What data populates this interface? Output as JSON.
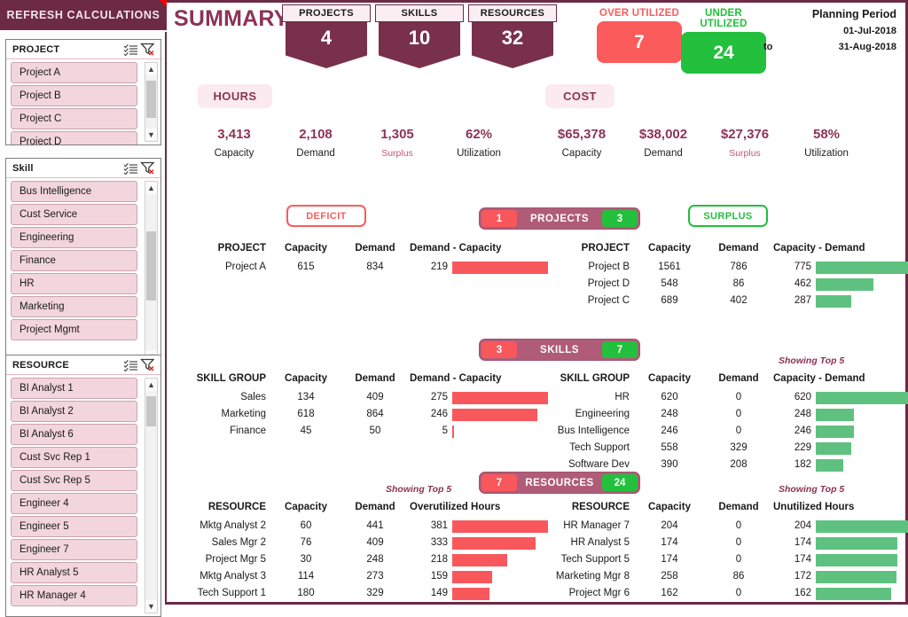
{
  "sidebar": {
    "refresh_label": "REFRESH CALCULATIONS",
    "slicers": [
      {
        "title": "PROJECT",
        "multiselect_icon": "multi-select-icon",
        "clear_icon": "clear-filter-icon",
        "items": [
          "Project A",
          "Project B",
          "Project C",
          "Project D"
        ]
      },
      {
        "title": "Skill",
        "multiselect_icon": "multi-select-icon",
        "clear_icon": "clear-filter-icon",
        "items": [
          "Bus Intelligence",
          "Cust Service",
          "Engineering",
          "Finance",
          "HR",
          "Marketing",
          "Project Mgmt"
        ]
      },
      {
        "title": "RESOURCE",
        "multiselect_icon": "multi-select-icon",
        "clear_icon": "clear-filter-icon",
        "items": [
          "BI Analyst 1",
          "BI Analyst 2",
          "BI Analyst 6",
          "Cust Svc Rep 1",
          "Cust Svc Rep 5",
          "Engineer 4",
          "Engineer 5",
          "Engineer 7",
          "HR Analyst 5",
          "HR Manager 4"
        ]
      }
    ]
  },
  "header": {
    "title": "SUMMARY",
    "kpis": [
      {
        "label": "PROJECTS",
        "value": "4"
      },
      {
        "label": "SKILLS",
        "value": "10"
      },
      {
        "label": "RESOURCES",
        "value": "32"
      }
    ],
    "utilization": [
      {
        "label": "OVER UTILIZED",
        "value": "7",
        "color": "#fb5b5b"
      },
      {
        "label": "UNDER UTILIZED",
        "value": "24",
        "color": "#22c03c"
      }
    ],
    "planning_period": {
      "title": "Planning Period",
      "from": "01-Jul-2018",
      "to_label": "to",
      "to": "31-Aug-2018"
    }
  },
  "metrics": {
    "hours_label": "HOURS",
    "cost_label": "COST",
    "hours": [
      {
        "value": "3,413",
        "label": "Capacity"
      },
      {
        "value": "2,108",
        "label": "Demand"
      },
      {
        "value": "1,305",
        "label": "Surplus"
      },
      {
        "value": "62%",
        "label": "Utilization"
      }
    ],
    "cost": [
      {
        "value": "$65,378",
        "label": "Capacity"
      },
      {
        "value": "$38,002",
        "label": "Demand"
      },
      {
        "value": "$27,376",
        "label": "Surplus"
      },
      {
        "value": "58%",
        "label": "Utilization"
      }
    ]
  },
  "sections": [
    {
      "id": "projects",
      "pill": {
        "over": "1",
        "name": "PROJECTS",
        "under": "3"
      },
      "left_tag": "DEFICIT",
      "right_tag": "SURPLUS",
      "left_showing": "",
      "right_showing": "",
      "left_headers": [
        "PROJECT",
        "Capacity",
        "Demand",
        "Demand - Capacity"
      ],
      "left_rows": [
        {
          "name": "Project A",
          "capacity": "615",
          "demand": "834",
          "diff": "219",
          "pct": 100
        }
      ],
      "right_headers": [
        "PROJECT",
        "Capacity",
        "Demand",
        "Capacity - Demand"
      ],
      "right_rows": [
        {
          "name": "Project B",
          "capacity": "1561",
          "demand": "786",
          "diff": "775",
          "pct": 100
        },
        {
          "name": "Project D",
          "capacity": "548",
          "demand": "86",
          "diff": "462",
          "pct": 60
        },
        {
          "name": "Project C",
          "capacity": "689",
          "demand": "402",
          "diff": "287",
          "pct": 37
        }
      ]
    },
    {
      "id": "skills",
      "pill": {
        "over": "3",
        "name": "SKILLS",
        "under": "7"
      },
      "left_tag": "",
      "right_tag": "",
      "left_showing": "",
      "right_showing": "Showing Top 5",
      "left_headers": [
        "SKILL GROUP",
        "Capacity",
        "Demand",
        "Demand - Capacity"
      ],
      "left_rows": [
        {
          "name": "Sales",
          "capacity": "134",
          "demand": "409",
          "diff": "275",
          "pct": 100
        },
        {
          "name": "Marketing",
          "capacity": "618",
          "demand": "864",
          "diff": "246",
          "pct": 89
        },
        {
          "name": "Finance",
          "capacity": "45",
          "demand": "50",
          "diff": "5",
          "pct": 2
        }
      ],
      "right_headers": [
        "SKILL GROUP",
        "Capacity",
        "Demand",
        "Capacity - Demand"
      ],
      "right_rows": [
        {
          "name": "HR",
          "capacity": "620",
          "demand": "0",
          "diff": "620",
          "pct": 100
        },
        {
          "name": "Engineering",
          "capacity": "248",
          "demand": "0",
          "diff": "248",
          "pct": 40
        },
        {
          "name": "Bus Intelligence",
          "capacity": "246",
          "demand": "0",
          "diff": "246",
          "pct": 40
        },
        {
          "name": "Tech Support",
          "capacity": "558",
          "demand": "329",
          "diff": "229",
          "pct": 37
        },
        {
          "name": "Software Dev",
          "capacity": "390",
          "demand": "208",
          "diff": "182",
          "pct": 29
        }
      ]
    },
    {
      "id": "resources",
      "pill": {
        "over": "7",
        "name": "RESOURCES",
        "under": "24"
      },
      "left_tag": "",
      "right_tag": "",
      "left_showing": "Showing Top 5",
      "right_showing": "Showing Top 5",
      "left_headers": [
        "RESOURCE",
        "Capacity",
        "Demand",
        "Overutilized Hours"
      ],
      "left_rows": [
        {
          "name": "Mktg Analyst 2",
          "capacity": "60",
          "demand": "441",
          "diff": "381",
          "pct": 100
        },
        {
          "name": "Sales Mgr 2",
          "capacity": "76",
          "demand": "409",
          "diff": "333",
          "pct": 87
        },
        {
          "name": "Project Mgr 5",
          "capacity": "30",
          "demand": "248",
          "diff": "218",
          "pct": 57
        },
        {
          "name": "Mktg Analyst 3",
          "capacity": "114",
          "demand": "273",
          "diff": "159",
          "pct": 42
        },
        {
          "name": "Tech Support 1",
          "capacity": "180",
          "demand": "329",
          "diff": "149",
          "pct": 39
        }
      ],
      "right_headers": [
        "RESOURCE",
        "Capacity",
        "Demand",
        "Unutilized Hours"
      ],
      "right_rows": [
        {
          "name": "HR Manager 7",
          "capacity": "204",
          "demand": "0",
          "diff": "204",
          "pct": 100
        },
        {
          "name": "HR Analyst 5",
          "capacity": "174",
          "demand": "0",
          "diff": "174",
          "pct": 85
        },
        {
          "name": "Tech Support 5",
          "capacity": "174",
          "demand": "0",
          "diff": "174",
          "pct": 85
        },
        {
          "name": "Marketing Mgr 8",
          "capacity": "258",
          "demand": "86",
          "diff": "172",
          "pct": 84
        },
        {
          "name": "Project Mgr 6",
          "capacity": "162",
          "demand": "0",
          "diff": "162",
          "pct": 79
        }
      ]
    }
  ],
  "colors": {
    "brand": "#6d2a45",
    "accent": "#8d3355",
    "pill": "#b05c78",
    "red": "#f8585c",
    "green": "#5ec17f",
    "deficit_text": "#fb5b5b",
    "surplus_text": "#22c03c"
  }
}
